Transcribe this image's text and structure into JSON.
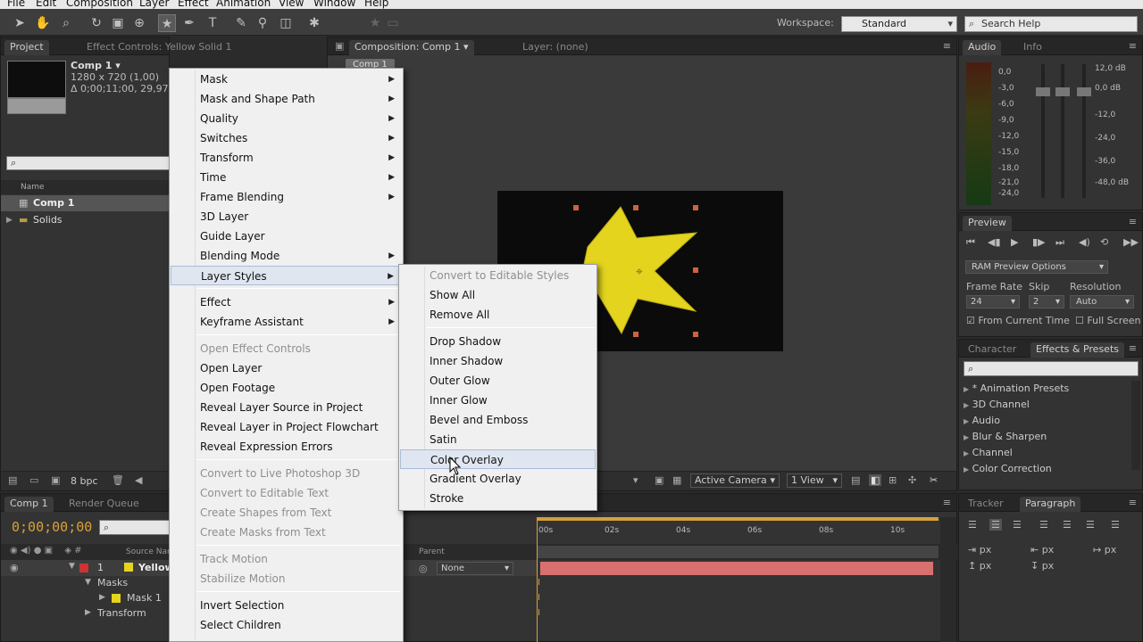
{
  "menubar": {
    "items": [
      "File",
      "Edit",
      "Composition",
      "Layer",
      "Effect",
      "Animation",
      "View",
      "Window",
      "Help"
    ]
  },
  "toolbar": {
    "workspace_label": "Workspace:",
    "workspace_value": "Standard",
    "search_placeholder": "Search Help"
  },
  "project": {
    "tabs": [
      "Project",
      "Effect Controls: Yellow Solid 1"
    ],
    "comp_name": "Comp 1 ▾",
    "comp_res": "1280 x 720 (1,00)",
    "comp_dur": "Δ 0;00;11;00, 29,97 fps",
    "column_name": "Name",
    "items": [
      {
        "label": "Comp 1"
      },
      {
        "label": "Solids"
      }
    ],
    "bpc": "8 bpc"
  },
  "composition": {
    "tabs": [
      "Composition: Comp 1",
      "Layer: (none)"
    ],
    "subtab": "Comp 1",
    "view_camera": "Active Camera",
    "view_count": "1 View"
  },
  "audio": {
    "tabs": [
      "Audio",
      "Info"
    ],
    "left_scale": [
      "0,0",
      "-3,0",
      "-6,0",
      "-9,0",
      "-12,0",
      "-15,0",
      "-18,0",
      "-21,0",
      "-24,0"
    ],
    "right_scale": [
      "12,0 dB",
      "0,0 dB",
      "-12,0",
      "-24,0",
      "-36,0",
      "-48,0 dB"
    ]
  },
  "preview": {
    "tab": "Preview",
    "ram_options": "RAM Preview Options",
    "frame_rate_label": "Frame Rate",
    "frame_rate": "24",
    "skip_label": "Skip",
    "skip": "2",
    "resolution_label": "Resolution",
    "resolution": "Auto",
    "from_current": "From Current Time",
    "full_screen": "Full Screen"
  },
  "effects": {
    "tabs": [
      "Character",
      "Effects & Presets"
    ],
    "items": [
      "* Animation Presets",
      "3D Channel",
      "Audio",
      "Blur & Sharpen",
      "Channel",
      "Color Correction"
    ]
  },
  "paragraph": {
    "tabs": [
      "Tracker",
      "Paragraph"
    ],
    "px": "px"
  },
  "timeline": {
    "tabs": [
      "Comp 1",
      "Render Queue"
    ],
    "timecode": "0;00;00;00",
    "source_name_col": "Source Name",
    "parent_col": "Parent",
    "parent_value": "None",
    "layer_num": "1",
    "layer_name": "Yellow",
    "masks": "Masks",
    "mask1": "Mask 1",
    "transform": "Transform",
    "ruler": [
      "00s",
      "02s",
      "04s",
      "06s",
      "08s",
      "10s"
    ]
  },
  "layer_menu": {
    "items": [
      {
        "label": "Mask",
        "sub": true,
        "disabled": false
      },
      {
        "label": "Mask and Shape Path",
        "sub": true,
        "disabled": false
      },
      {
        "label": "Quality",
        "sub": true,
        "disabled": false
      },
      {
        "label": "Switches",
        "sub": true,
        "disabled": false
      },
      {
        "label": "Transform",
        "sub": true,
        "disabled": false
      },
      {
        "label": "Time",
        "sub": true,
        "disabled": false
      },
      {
        "label": "Frame Blending",
        "sub": true,
        "disabled": false
      },
      {
        "label": "3D Layer",
        "sub": false,
        "disabled": false
      },
      {
        "label": "Guide Layer",
        "sub": false,
        "disabled": false
      },
      {
        "label": "Blending Mode",
        "sub": true,
        "disabled": false
      },
      {
        "label": "Layer Styles",
        "sub": true,
        "disabled": false
      },
      {
        "label": "Effect",
        "sub": true,
        "disabled": false
      },
      {
        "label": "Keyframe Assistant",
        "sub": true,
        "disabled": false
      },
      {
        "label": "Open Effect Controls",
        "sub": false,
        "disabled": true
      },
      {
        "label": "Open Layer",
        "sub": false,
        "disabled": false
      },
      {
        "label": "Open Footage",
        "sub": false,
        "disabled": false
      },
      {
        "label": "Reveal Layer Source in Project",
        "sub": false,
        "disabled": false
      },
      {
        "label": "Reveal Layer in Project Flowchart",
        "sub": false,
        "disabled": false
      },
      {
        "label": "Reveal Expression Errors",
        "sub": false,
        "disabled": false
      },
      {
        "label": "Convert to Live Photoshop 3D",
        "sub": false,
        "disabled": true
      },
      {
        "label": "Convert to Editable Text",
        "sub": false,
        "disabled": true
      },
      {
        "label": "Create Shapes from Text",
        "sub": false,
        "disabled": true
      },
      {
        "label": "Create Masks from Text",
        "sub": false,
        "disabled": true
      },
      {
        "label": "Track Motion",
        "sub": false,
        "disabled": true
      },
      {
        "label": "Stabilize Motion",
        "sub": false,
        "disabled": true
      },
      {
        "label": "Invert Selection",
        "sub": false,
        "disabled": false
      },
      {
        "label": "Select Children",
        "sub": false,
        "disabled": false
      }
    ]
  },
  "styles_menu": {
    "items": [
      {
        "label": "Convert to Editable Styles",
        "disabled": true
      },
      {
        "label": "Show All",
        "disabled": false
      },
      {
        "label": "Remove All",
        "disabled": false
      },
      {
        "label": "Drop Shadow",
        "disabled": false
      },
      {
        "label": "Inner Shadow",
        "disabled": false
      },
      {
        "label": "Outer Glow",
        "disabled": false
      },
      {
        "label": "Inner Glow",
        "disabled": false
      },
      {
        "label": "Bevel and Emboss",
        "disabled": false
      },
      {
        "label": "Satin",
        "disabled": false
      },
      {
        "label": "Color Overlay",
        "disabled": false
      },
      {
        "label": "Gradient Overlay",
        "disabled": false
      },
      {
        "label": "Stroke",
        "disabled": false
      }
    ]
  },
  "colors": {
    "star": "#e4d41e",
    "layer_bar": "#d97070",
    "menu_highlight": "#dfe6f0",
    "timecode": "#d7a23a"
  }
}
